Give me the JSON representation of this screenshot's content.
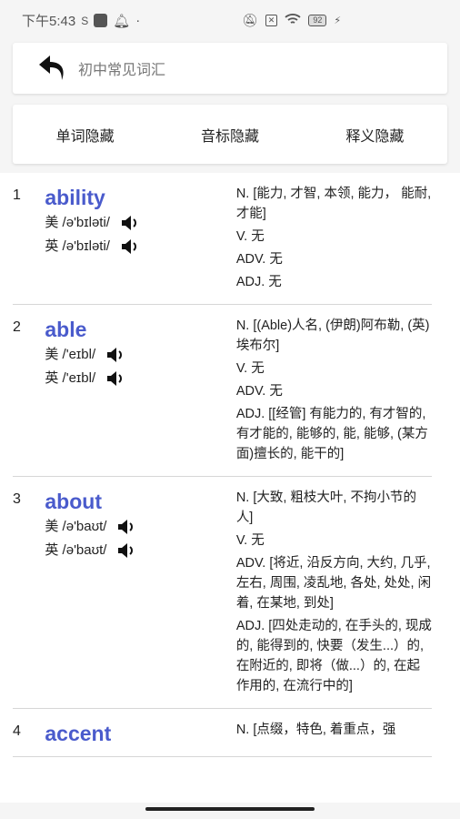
{
  "status_bar": {
    "time": "下午5:43",
    "battery": "92"
  },
  "header": {
    "title": "初中常见词汇",
    "back_icon": "back-arrow-icon"
  },
  "toggles": [
    "单词隐藏",
    "音标隐藏",
    "释义隐藏"
  ],
  "colors": {
    "word": "#4a5bcc",
    "divider": "#d6d6d6"
  },
  "entries": [
    {
      "index": "1",
      "word": "ability",
      "us": "美 /ə'bɪləti/",
      "uk": "英 /ə'bɪləti/",
      "defs": [
        "N. [能力, 才智, 本领, 能力， 能耐, 才能]",
        "V. 无",
        "ADV. 无",
        "ADJ. 无"
      ]
    },
    {
      "index": "2",
      "word": "able",
      "us": "美 /'eɪbl/",
      "uk": "英 /'eɪbl/",
      "defs": [
        "N. [(Able)人名, (伊朗)阿布勒, (英)埃布尔]",
        "V. 无",
        "ADV. 无",
        "ADJ. [[经管] 有能力的, 有才智的, 有才能的, 能够的, 能, 能够, (某方面)擅长的, 能干的]"
      ]
    },
    {
      "index": "3",
      "word": "about",
      "us": "美 /ə'baʊt/",
      "uk": "英 /ə'baʊt/",
      "defs": [
        "N. [大致, 粗枝大叶, 不拘小节的人]",
        "V. 无",
        "ADV. [将近, 沿反方向, 大约, 几乎, 左右, 周围, 凌乱地, 各处, 处处, 闲着, 在某地, 到处]",
        "ADJ. [四处走动的, 在手头的, 现成的, 能得到的, 快要（发生...）的, 在附近的, 即将（做...）的, 在起作用的, 在流行中的]"
      ]
    },
    {
      "index": "4",
      "word": "accent",
      "defs": [
        "N. [点缀，特色, 着重点，强"
      ]
    }
  ]
}
